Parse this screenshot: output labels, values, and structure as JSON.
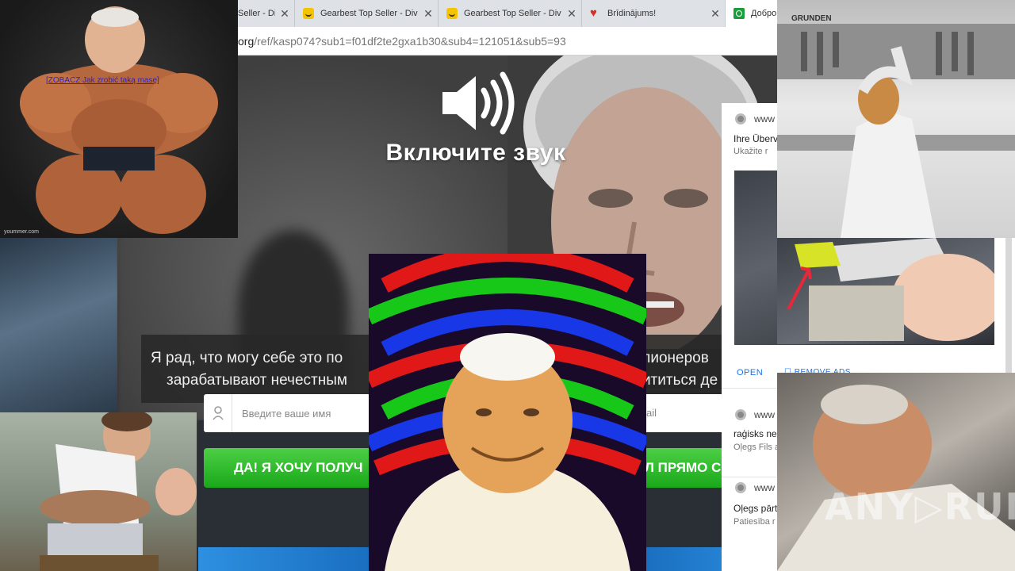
{
  "browser": {
    "tabs": [
      {
        "title": "Seller - Div",
        "favicon": "gearbest-icon"
      },
      {
        "title": "Gearbest Top Seller - Div",
        "favicon": "gearbest-icon"
      },
      {
        "title": "Gearbest Top Seller - Div",
        "favicon": "gearbest-icon"
      },
      {
        "title": "Brīdinājums!",
        "favicon": "heart-icon"
      },
      {
        "title": "Добро",
        "favicon": "green-site-icon"
      }
    ],
    "url_prefix": "org",
    "url_rest": "/ref/kasp074?sub1=f01df2te2gxa1b30&sub4=121051&sub5=93"
  },
  "video": {
    "sound_label": "Включите звук",
    "subtitle_line1": "Я рад, что могу себе это по",
    "subtitle_line1_tail": "ллионеров",
    "subtitle_line2": "зарабатывают нечестным",
    "subtitle_line2_tail": "ититься де"
  },
  "form": {
    "name_placeholder": "Введите ваше имя",
    "email_fragment": "ail",
    "cta_left": "ДА! Я ХОЧУ ПОЛУЧ",
    "cta_right": "Л ПРЯМО СЕ"
  },
  "ads": {
    "card1": {
      "domain": "www",
      "title": "Ihre Überv",
      "subtitle": "Ukažite r",
      "open_label": "OPEN",
      "remove_label": "REMOVE ADS"
    },
    "card2": {
      "domain": "www",
      "title": "raģisks nel",
      "subtitle": "Oļegs Fils a"
    },
    "card3": {
      "domain": "www",
      "title": "Oļegs pārt",
      "subtitle": "Patiesība r"
    }
  },
  "overlays": {
    "bodybuilder_link": "[ZOBACZ Jak zrobić taką masę]",
    "bodybuilder_mark": "yoummer.com",
    "shop_sign": "GRUNDEN",
    "watermark": "ANY▷RUN"
  },
  "colors": {
    "cta_green": "#19a819",
    "ad_link_blue": "#1a73e8",
    "browser_tabbar": "#dee1e6"
  }
}
